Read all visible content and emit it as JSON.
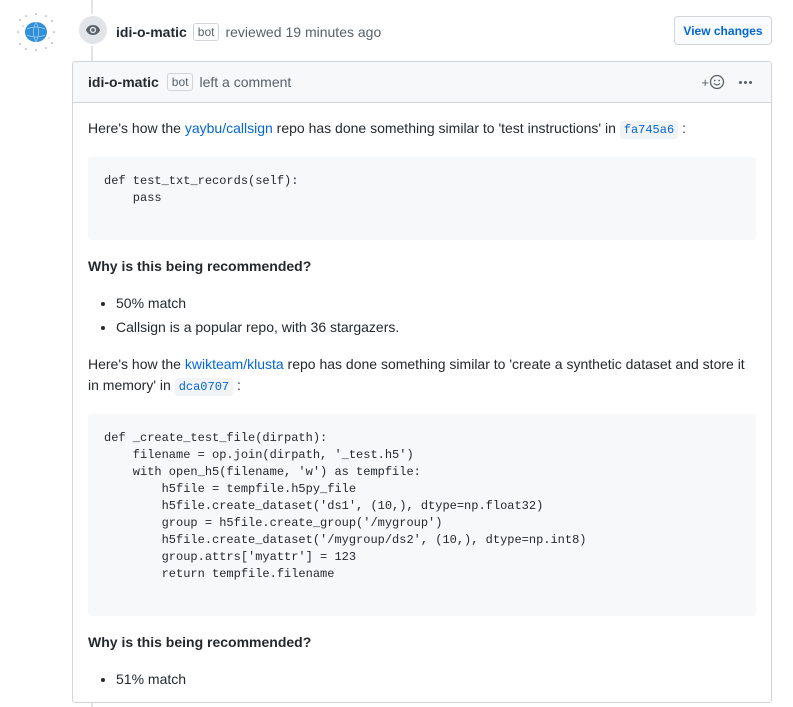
{
  "review": {
    "author": "idi-o-matic",
    "bot_label": "bot",
    "action": "reviewed",
    "time": "19 minutes ago",
    "view_changes_label": "View changes"
  },
  "comment": {
    "author": "idi-o-matic",
    "bot_label": "bot",
    "action": "left a comment",
    "reaction_plus": "+",
    "suggestions": [
      {
        "intro_before": "Here's how the ",
        "repo": "yaybu/callsign",
        "intro_after": " repo has done something similar to 'test instructions' in ",
        "sha": "fa745a6",
        "trailing": ":",
        "code": "def test_txt_records(self):\n    pass",
        "why_heading": "Why is this being recommended?",
        "reasons": [
          "50% match",
          "Callsign is a popular repo, with 36 stargazers."
        ]
      },
      {
        "intro_before": "Here's how the ",
        "repo": "kwikteam/klusta",
        "intro_after": " repo has done something similar to 'create a synthetic dataset and store it in memory' in ",
        "sha": "dca0707",
        "trailing": ":",
        "code": "def _create_test_file(dirpath):\n    filename = op.join(dirpath, '_test.h5')\n    with open_h5(filename, 'w') as tempfile:\n        h5file = tempfile.h5py_file\n        h5file.create_dataset('ds1', (10,), dtype=np.float32)\n        group = h5file.create_group('/mygroup')\n        h5file.create_dataset('/mygroup/ds2', (10,), dtype=np.int8)\n        group.attrs['myattr'] = 123\n        return tempfile.filename",
        "why_heading": "Why is this being recommended?",
        "reasons": [
          "51% match"
        ]
      }
    ]
  },
  "colors": {
    "link": "#0366d6",
    "border": "#d1d5da",
    "header_bg": "#f6f8fa",
    "avatar": "#2f8fd8"
  }
}
